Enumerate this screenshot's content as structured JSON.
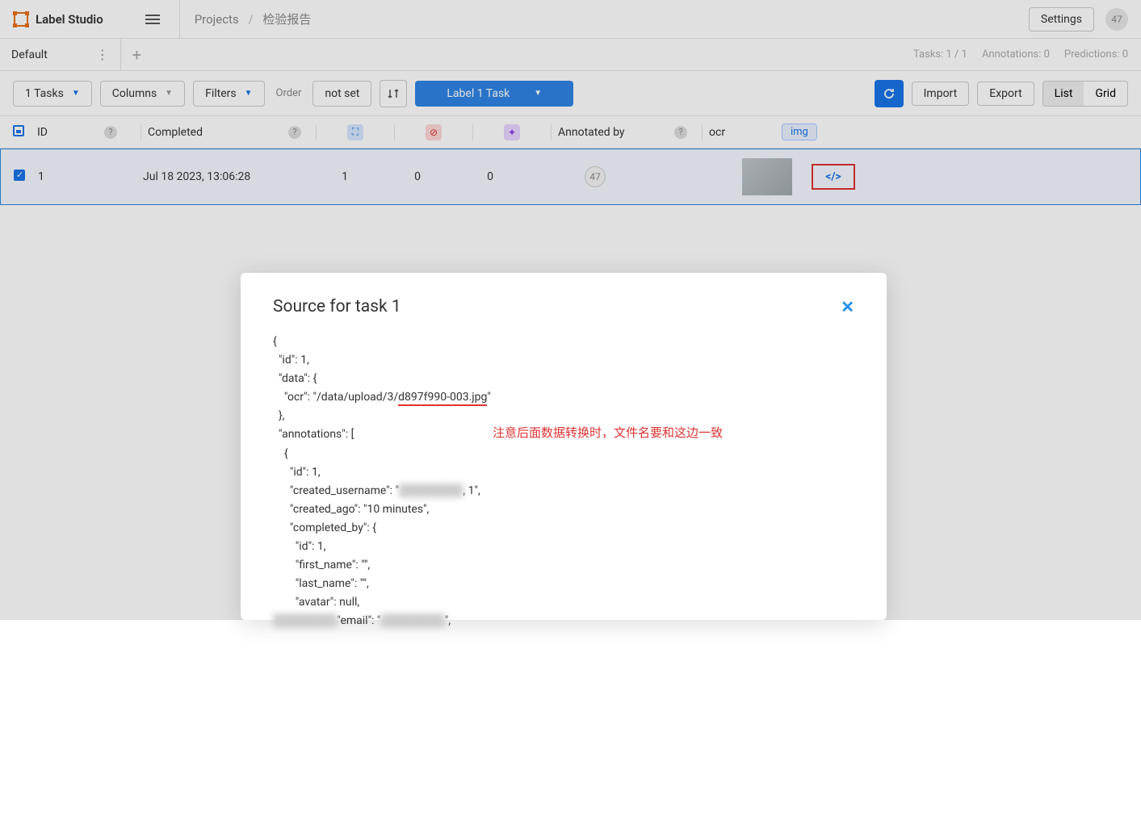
{
  "header": {
    "brand": "Label Studio",
    "breadcrumb": {
      "root": "Projects",
      "current": "检验报告"
    },
    "settings": "Settings",
    "badge": "47"
  },
  "tabs": {
    "active": "Default"
  },
  "stats": {
    "tasks": "Tasks: 1 / 1",
    "annotations": "Annotations: 0",
    "predictions": "Predictions: 0"
  },
  "toolbar": {
    "tasks": "1 Tasks",
    "columns": "Columns",
    "filters": "Filters",
    "order_label": "Order",
    "order_value": "not set",
    "label_btn": "Label 1 Task",
    "import": "Import",
    "export": "Export",
    "view_list": "List",
    "view_grid": "Grid"
  },
  "columns": {
    "id": "ID",
    "completed": "Completed",
    "annotated_by": "Annotated by",
    "ocr": "ocr",
    "img": "img"
  },
  "row": {
    "id": "1",
    "completed": "Jul 18 2023, 13:06:28",
    "c1": "1",
    "c2": "0",
    "c3": "0",
    "avatar": "47"
  },
  "modal": {
    "title": "Source for task 1",
    "json_lines": [
      "{",
      "  \"id\": 1,",
      "  \"data\": {",
      "    \"ocr\": \"/data/upload/3/d897f990-003.jpg\"",
      "  },",
      "  \"annotations\": [",
      "    {",
      "      \"id\": 1,",
      "      \"created_username\": \"                   , 1\",",
      "      \"created_ago\": \"10 minutes\",",
      "      \"completed_by\": {",
      "        \"id\": 1,",
      "        \"first_name\": \"\",",
      "        \"last_name\": \"\",",
      "        \"avatar\": null,",
      "        \"email\": \"                  \","
    ],
    "underline_text": "d897f990-003.jpg"
  },
  "annotation_note": "注意后面数据转换时，文件名要和这边一致"
}
